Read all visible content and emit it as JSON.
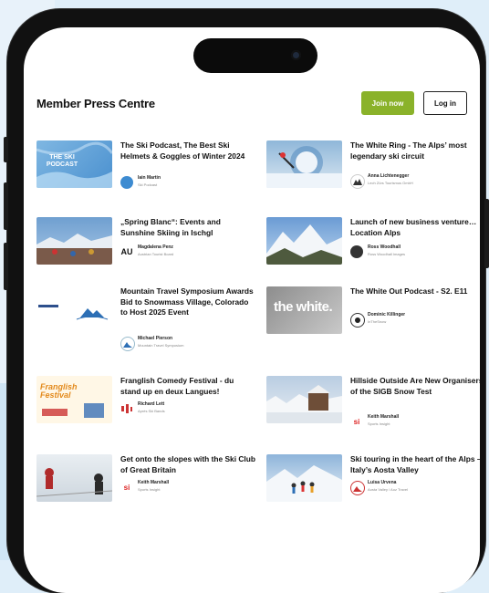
{
  "page": {
    "title": "Member Press Centre",
    "join_label": "Join now",
    "login_label": "Log in"
  },
  "articles": [
    {
      "headline": "The Ski Podcast, The Best Ski Helmets & Goggles of Winter 2024",
      "author": "Iain Martin",
      "org": "Ski Podcast",
      "thumb_text": "THE SKI PODCAST"
    },
    {
      "headline": "The White Ring - The Alps’ most legendary ski circuit",
      "author": "Anna Lichtenegger",
      "org": "Lech Zürs Tourismus GmbH"
    },
    {
      "headline": "„Spring Blanc“: Events and Sunshine Skiing in Ischgl",
      "author": "Magdalena Penz",
      "org": "Austrian Tourist Board",
      "logo_text": "AU"
    },
    {
      "headline": "Launch of new business venture… Location Alps",
      "author": "Ross Woodhall",
      "org": "Ross Woodhall Images"
    },
    {
      "headline": "Mountain Travel Symposium Awards Bid to Snowmass Village, Colorado to Host 2025 Event",
      "author": "Michael Pierson",
      "org": "Mountain Travel Symposium"
    },
    {
      "headline": "The White Out Podcast - S2. E11",
      "author": "Dominic Killinger",
      "org": "InTheSnow",
      "thumb_text": "the white."
    },
    {
      "headline": "Franglish Comedy Festival - du stand up en deux Langues!",
      "author": "Richard Lett",
      "org": "Après Ski Bands",
      "thumb_text": "Franglish Festival"
    },
    {
      "headline": "Hillside Outside Are New Organisers of the SIGB Snow Test",
      "author": "Keith Marshall",
      "org": "Sports Insight",
      "logo_text": "si"
    },
    {
      "headline": "Get onto the slopes with the Ski Club of Great Britain",
      "author": "Keith Marshall",
      "org": "Sports Insight",
      "logo_text": "si"
    },
    {
      "headline": "Ski touring in the heart of the Alps – Italy’s Aosta Valley",
      "author": "Luisa Urvena",
      "org": "Aosta Valley / Aoz Travel"
    }
  ],
  "colors": {
    "accent": "#8ab22a",
    "frame": "#111111",
    "background": "#dfeef9"
  },
  "icons": [
    "camera-icon"
  ]
}
